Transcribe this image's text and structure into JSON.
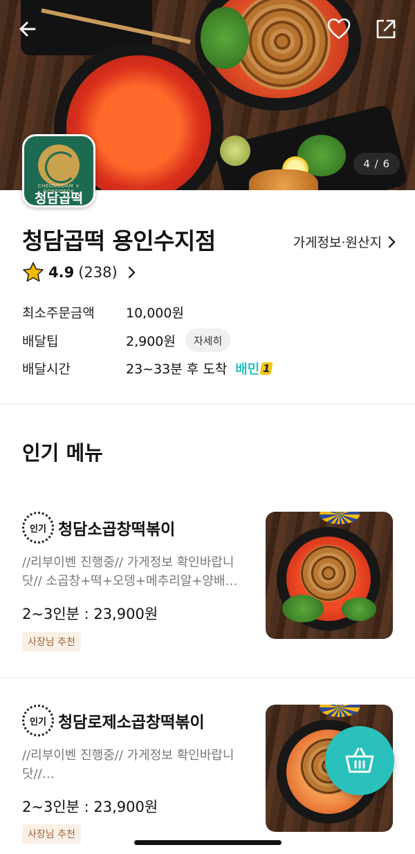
{
  "header": {
    "back_icon": "arrow-left-icon",
    "favorite_icon": "heart-icon",
    "share_icon": "share-icon",
    "image_counter": "4 / 6"
  },
  "logo": {
    "tagline": "CHEONGDAM × GOBDDEOK",
    "name": "청담곱떡"
  },
  "store": {
    "name": "청담곱떡 용인수지점",
    "info_link": "가게정보·원산지",
    "rating": "4.9",
    "review_count": "(238)",
    "min_order_label": "최소주문금액",
    "min_order_value": "10,000원",
    "delivery_tip_label": "배달팁",
    "delivery_tip_value": "2,900원",
    "detail_button": "자세히",
    "delivery_time_label": "배달시간",
    "delivery_time_value": "23~33분 후 도착",
    "baemin_badge": "배민",
    "baemin_badge_num": "1"
  },
  "popular": {
    "title": "인기 메뉴",
    "items": [
      {
        "badge": "인기",
        "name": "청담소곱창떡볶이",
        "desc": "//리부이벤 진행중// 가게정보 확인바랍니닷//   소곱창+떡+오뎅+메추리알+양배…",
        "price": "2~3인분 : 23,900원",
        "tag": "사장님 추천"
      },
      {
        "badge": "인기",
        "name": "청담로제소곱창떡볶이",
        "desc": "//리부이벤 진행중// 가게정보 확인바랍니닷//…",
        "price": "2~3인분 : 23,900원",
        "tag": "사장님 추천"
      }
    ]
  },
  "cart": {
    "icon": "shopping-basket-icon"
  },
  "colors": {
    "accent": "#2ac1bc",
    "star": "#f5b800",
    "tag_bg": "#faf0e6",
    "tag_text": "#a0633a"
  }
}
